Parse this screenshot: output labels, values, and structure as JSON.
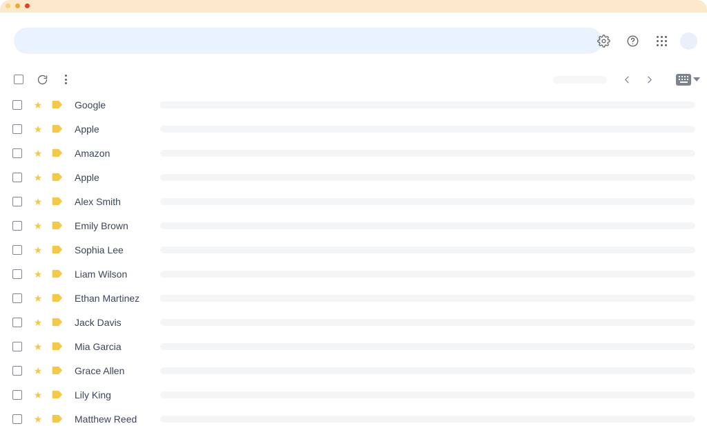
{
  "window": {
    "titlebar_color": "#fce8cb",
    "traffic_lights": [
      {
        "name": "close-dot",
        "color": "#f6d675"
      },
      {
        "name": "minimize-dot",
        "color": "#f0a830"
      },
      {
        "name": "maximize-dot",
        "color": "#e0422c"
      }
    ]
  },
  "header": {
    "search": {
      "value": "",
      "placeholder": "",
      "background": "#eaf2fd"
    },
    "icons": [
      {
        "name": "gear-icon",
        "label": "Settings"
      },
      {
        "name": "help-icon",
        "label": "Support"
      },
      {
        "name": "apps-grid-icon",
        "label": "Google apps"
      },
      {
        "name": "avatar",
        "label": "Account"
      }
    ]
  },
  "toolbar": {
    "select_all_label": "Select",
    "refresh_label": "Refresh",
    "more_label": "More",
    "page_count": "",
    "prev_label": "‹",
    "next_label": "›",
    "density_label": "Input tools"
  },
  "list": {
    "rows": [
      {
        "sender": "Google"
      },
      {
        "sender": "Apple"
      },
      {
        "sender": "Amazon"
      },
      {
        "sender": "Apple"
      },
      {
        "sender": "Alex Smith"
      },
      {
        "sender": "Emily Brown"
      },
      {
        "sender": "Sophia Lee"
      },
      {
        "sender": "Liam Wilson"
      },
      {
        "sender": "Ethan Martinez"
      },
      {
        "sender": "Jack Davis"
      },
      {
        "sender": "Mia Garcia"
      },
      {
        "sender": "Grace Allen"
      },
      {
        "sender": "Lily King"
      },
      {
        "sender": "Matthew Reed"
      }
    ],
    "star_color": "#f4c849",
    "tag_color": "#f4c849",
    "sender_color": "#3c455a",
    "skeleton_color": "#f4f5f6"
  }
}
